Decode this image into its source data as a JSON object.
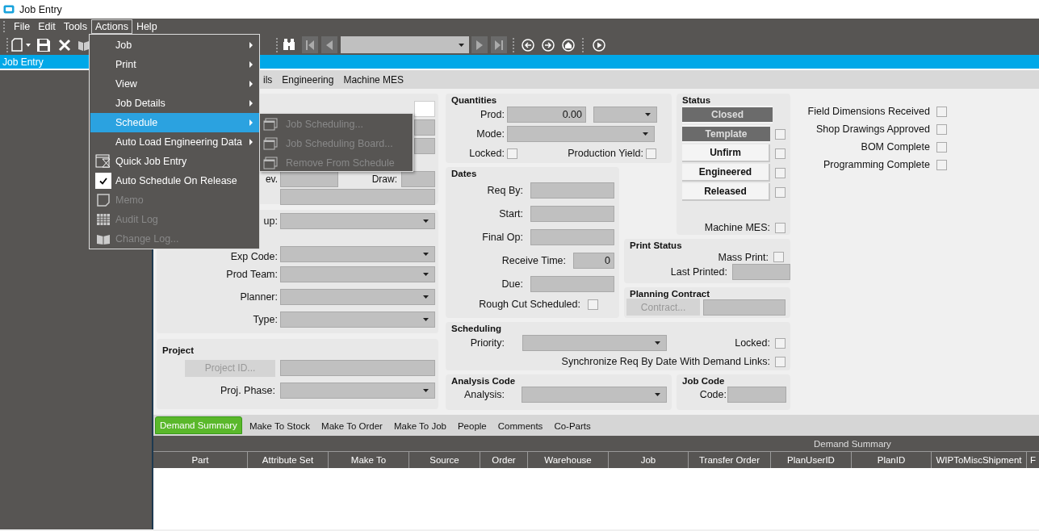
{
  "window": {
    "title": "Job Entry"
  },
  "menu_bar": [
    {
      "label": "File",
      "selected": false
    },
    {
      "label": "Edit",
      "selected": false
    },
    {
      "label": "Tools",
      "selected": false
    },
    {
      "label": "Actions",
      "selected": true
    },
    {
      "label": "Help",
      "selected": false
    }
  ],
  "actions_menu": [
    {
      "label": "Job",
      "kind": "submenu",
      "selected": false,
      "disabled": false
    },
    {
      "label": "Print",
      "kind": "submenu",
      "selected": false,
      "disabled": false
    },
    {
      "label": "View",
      "kind": "submenu",
      "selected": false,
      "disabled": false
    },
    {
      "label": "Job Details",
      "kind": "submenu",
      "selected": false,
      "disabled": false
    },
    {
      "label": "Schedule",
      "kind": "submenu",
      "selected": true,
      "disabled": false
    },
    {
      "label": "Auto Load Engineering Data",
      "kind": "submenu",
      "selected": false,
      "disabled": false
    },
    {
      "label": "Quick Job Entry",
      "kind": "command",
      "selected": false,
      "disabled": false
    },
    {
      "label": "Auto Schedule On Release",
      "kind": "toggle",
      "checked": true,
      "selected": false,
      "disabled": false
    },
    {
      "label": "Memo",
      "kind": "command",
      "selected": false,
      "disabled": true
    },
    {
      "label": "Audit Log",
      "kind": "command",
      "selected": false,
      "disabled": true
    },
    {
      "label": "Change Log...",
      "kind": "command",
      "selected": false,
      "disabled": true
    }
  ],
  "schedule_submenu": [
    {
      "label": "Job Scheduling...",
      "disabled": true
    },
    {
      "label": "Job Scheduling Board...",
      "disabled": true
    },
    {
      "label": "Remove From Schedule",
      "disabled": true
    }
  ],
  "panel_bar": {
    "title": "Job Entry"
  },
  "top_tabs": [
    {
      "label": "ils",
      "selected": false
    },
    {
      "label": "Engineering",
      "selected": false
    },
    {
      "label": "Machine MES",
      "selected": false
    }
  ],
  "job_box": {
    "rev_label": "ev.",
    "draw_label": "Draw:"
  },
  "group_box": {
    "fields": [
      {
        "label": "up:"
      },
      {
        "label": "Exp Code:"
      },
      {
        "label": "Prod Team:"
      },
      {
        "label": "Planner:"
      },
      {
        "label": "Type:"
      }
    ]
  },
  "project": {
    "title": "Project",
    "button": {
      "label": "Project ID...",
      "disabled": true
    },
    "phase_label": "Proj. Phase:"
  },
  "quantities": {
    "title": "Quantities",
    "prod_label": "Prod:",
    "prod_value": "0.00",
    "mode_label": "Mode:",
    "locked": {
      "label": "Locked:",
      "checked": false
    },
    "production_yield": {
      "label": "Production Yield:",
      "checked": false
    }
  },
  "dates": {
    "title": "Dates",
    "fields": [
      {
        "label": "Req By:",
        "kind": "date"
      },
      {
        "label": "Start:",
        "kind": "date"
      },
      {
        "label": "Final Op:",
        "kind": "date"
      },
      {
        "label": "Receive Time:",
        "kind": "number",
        "value": "0"
      },
      {
        "label": "Due:",
        "kind": "date"
      }
    ],
    "rough_cut": {
      "label": "Rough Cut Scheduled:",
      "checked": false
    }
  },
  "status": {
    "title": "Status",
    "buttons": [
      {
        "label": "Closed",
        "disabled": true
      },
      {
        "label": "Template",
        "disabled": true,
        "checked": false
      },
      {
        "label": "Unfirm",
        "disabled": false,
        "checked": false
      },
      {
        "label": "Engineered",
        "disabled": false,
        "checked": false
      },
      {
        "label": "Released",
        "disabled": false,
        "checked": false
      }
    ],
    "machine_mes": {
      "label": "Machine MES:",
      "checked": false
    }
  },
  "print_status": {
    "title": "Print Status",
    "mass_print": {
      "label": "Mass Print:",
      "checked": false
    },
    "last_printed_label": "Last Printed:"
  },
  "planning_contract": {
    "title": "Planning Contract",
    "button": {
      "label": "Contract...",
      "disabled": true
    }
  },
  "scheduling": {
    "title": "Scheduling",
    "priority_label": "Priority:",
    "locked": {
      "label": "Locked:",
      "checked": false
    },
    "synchronize": {
      "label": "Synchronize Req By Date With Demand Links:",
      "checked": false
    }
  },
  "analysis_code": {
    "title": "Analysis Code",
    "analysis_label": "Analysis:"
  },
  "job_code": {
    "title": "Job Code",
    "code_label": "Code:"
  },
  "milestones": [
    {
      "label": "Field Dimensions Received",
      "checked": false
    },
    {
      "label": "Shop Drawings Approved",
      "checked": false
    },
    {
      "label": "BOM Complete",
      "checked": false
    },
    {
      "label": "Programming Complete",
      "checked": false
    }
  ],
  "bottom_tabs": [
    {
      "label": "Demand Summary",
      "selected": true
    },
    {
      "label": "Make To Stock",
      "selected": false
    },
    {
      "label": "Make To Order",
      "selected": false
    },
    {
      "label": "Make To Job",
      "selected": false
    },
    {
      "label": "People",
      "selected": false
    },
    {
      "label": "Comments",
      "selected": false
    },
    {
      "label": "Co-Parts",
      "selected": false
    }
  ],
  "grid": {
    "title": "Demand Summary",
    "columns": [
      "Part",
      "Attribute Set",
      "Make To",
      "Source",
      "Order",
      "Warehouse",
      "Job",
      "Transfer Order",
      "PlanUserID",
      "PlanID",
      "WIPToMiscShipment",
      "F"
    ]
  }
}
